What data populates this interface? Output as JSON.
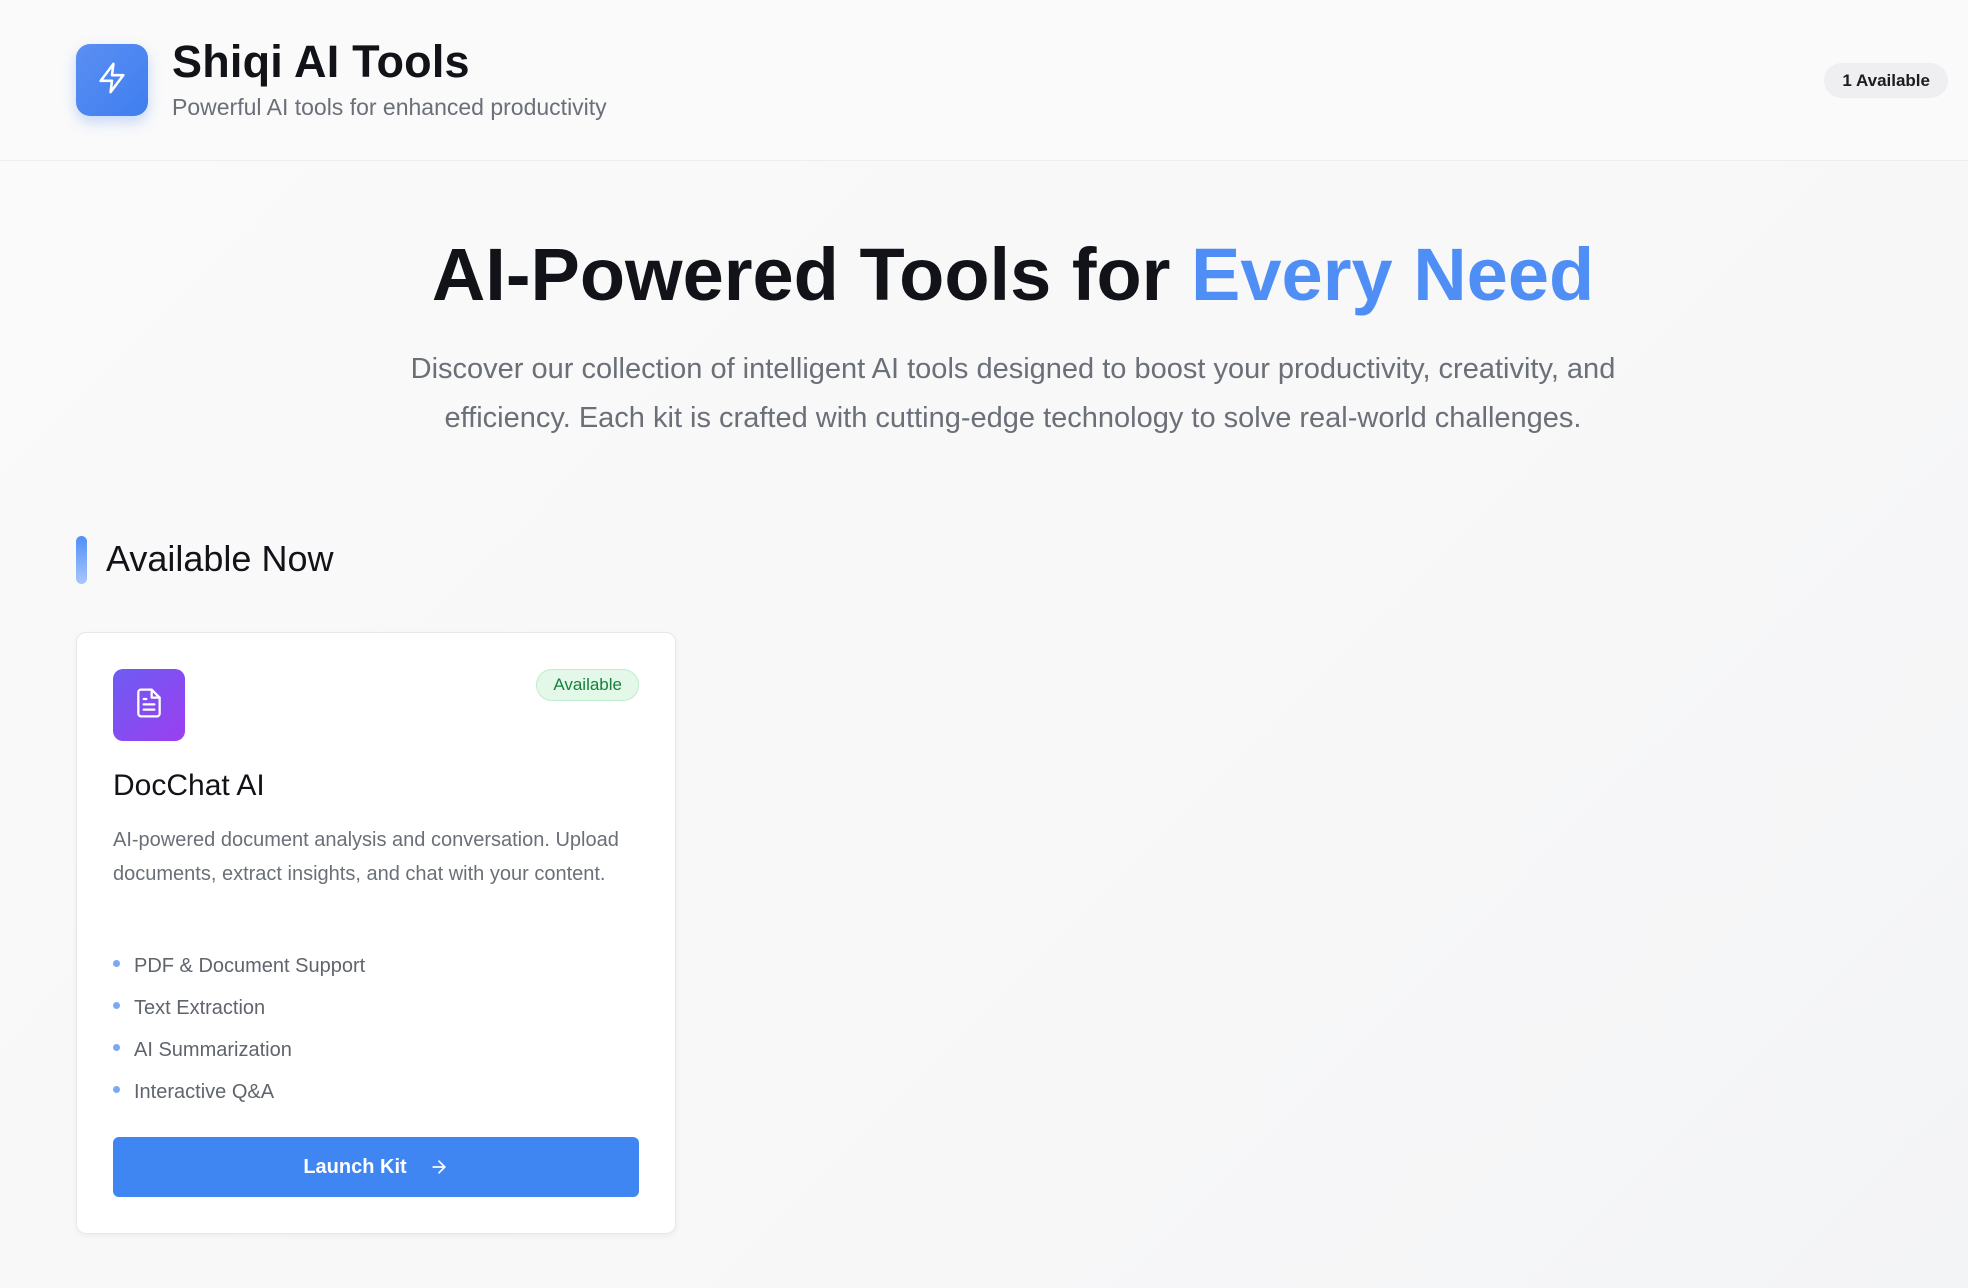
{
  "header": {
    "title": "Shiqi AI Tools",
    "subtitle": "Powerful AI tools for enhanced productivity",
    "available_count": "1 Available",
    "logo_icon": "lightning-icon",
    "logo_color": "#4f8ff5"
  },
  "hero": {
    "title_main": "AI-Powered Tools for ",
    "title_accent": "Every Need",
    "accent_color": "#4f8ff5",
    "description": "Discover our collection of intelligent AI tools designed to boost your productivity, creativity, and efficiency. Each kit is crafted with cutting-edge technology to solve real-world challenges."
  },
  "section": {
    "title": "Available Now"
  },
  "kits": [
    {
      "name": "DocChat AI",
      "icon": "document-icon",
      "status": "Available",
      "status_color": "#17803d",
      "description": "AI-powered document analysis and conversation. Upload documents, extract insights, and chat with your content.",
      "features": [
        "PDF & Document Support",
        "Text Extraction",
        "AI Summarization",
        "Interactive Q&A"
      ],
      "action_label": "Launch Kit",
      "action_icon": "arrow-right-icon",
      "action_color": "#3f86f2"
    }
  ]
}
